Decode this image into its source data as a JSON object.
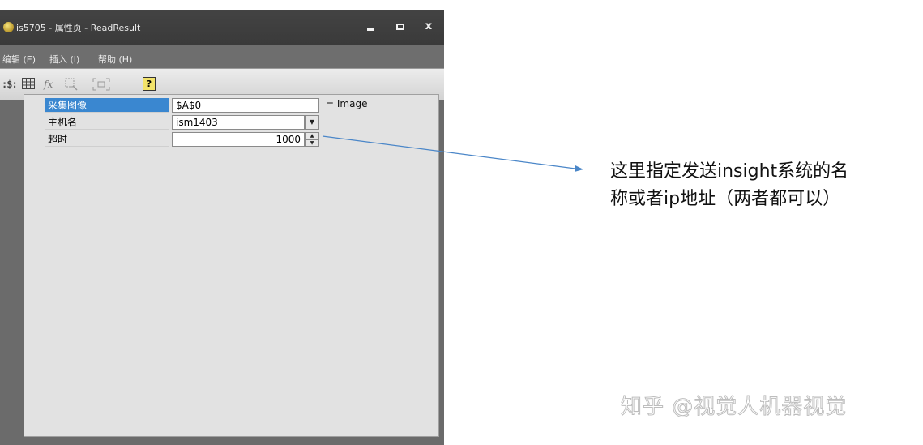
{
  "window": {
    "title": "is5705 - 属性页 - ReadResult",
    "controls": {
      "minimize": "–",
      "maximize": "□",
      "close": "x"
    }
  },
  "menu": {
    "items": [
      {
        "label": "编辑 (E)"
      },
      {
        "label": "插入 (I)"
      },
      {
        "label": "帮助 (H)"
      }
    ]
  },
  "toolbar": {
    "icons": [
      {
        "name": "spreadsheet-icon",
        "glyph": "$"
      },
      {
        "name": "grid-icon",
        "glyph": "☷"
      },
      {
        "name": "function-icon",
        "glyph": "fx"
      },
      {
        "name": "zoom-region-icon",
        "glyph": "⊡"
      },
      {
        "name": "fit-icon",
        "glyph": "⌗"
      },
      {
        "name": "help-icon",
        "glyph": "?"
      }
    ]
  },
  "properties": {
    "rows": [
      {
        "label": "采集图像",
        "value": "$A$0",
        "selected": true
      },
      {
        "label": "主机名",
        "value": "ism1403",
        "control": "dropdown"
      },
      {
        "label": "超时",
        "value": "1000",
        "control": "spinner"
      }
    ],
    "result": "= Image"
  },
  "annotation": {
    "line1": "这里指定发送insight系统的名",
    "line2": "称或者ip地址（两者都可以）"
  },
  "watermark": "知乎 @视觉人机器视觉",
  "colors": {
    "titlebar": "#3d3d3d",
    "menubar": "#6e6e6e",
    "selection": "#3a87d0",
    "arrow": "#4a86c8"
  }
}
